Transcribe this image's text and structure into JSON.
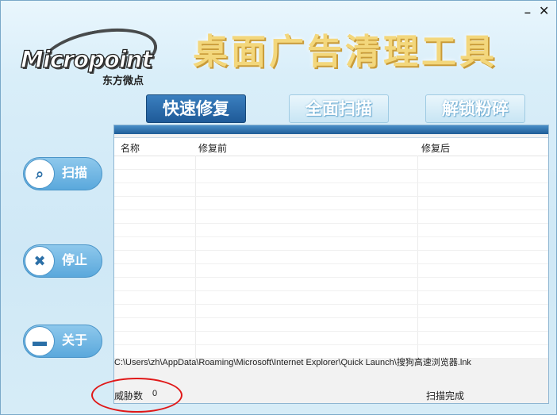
{
  "window": {
    "minimize": "–",
    "close": "✕"
  },
  "logo": {
    "brand": "Micropoint",
    "sub": "东方微点"
  },
  "app_title": "桌面广告清理工具",
  "tabs": [
    {
      "label": "快速修复",
      "active": true
    },
    {
      "label": "全面扫描",
      "active": false
    },
    {
      "label": "解锁粉碎",
      "active": false
    }
  ],
  "side_buttons": [
    {
      "label": "扫描",
      "icon": "search-icon",
      "glyph": "⌕"
    },
    {
      "label": "停止",
      "icon": "stop-icon",
      "glyph": "✖"
    },
    {
      "label": "关于",
      "icon": "message-icon",
      "glyph": "▬"
    }
  ],
  "table": {
    "columns": [
      "名称",
      "修复前",
      "修复后"
    ],
    "rows": []
  },
  "current_path": "C:\\Users\\zh\\AppData\\Roaming\\Microsoft\\Internet Explorer\\Quick Launch\\搜狗高速浏览器.lnk",
  "threats": {
    "label": "威胁数",
    "count": "0"
  },
  "status": "扫描完成",
  "colors": {
    "accent": "#1e5a98",
    "highlight_ring": "#e01818"
  }
}
